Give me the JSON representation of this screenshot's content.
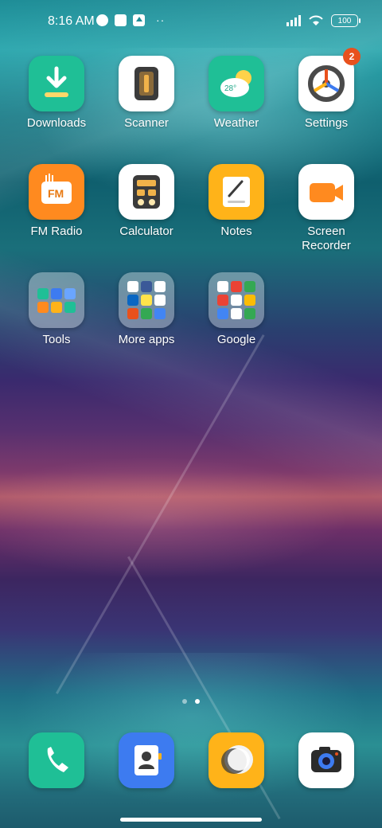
{
  "status_bar": {
    "time": "8:16 AM",
    "battery": "100",
    "more": "··"
  },
  "apps": [
    {
      "label": "Downloads",
      "icon": "download-icon",
      "color": "#1fbf96"
    },
    {
      "label": "Scanner",
      "icon": "scanner-icon",
      "color": "#ffffff"
    },
    {
      "label": "Weather",
      "icon": "weather-icon",
      "color": "#1fbf96",
      "temp": "28°"
    },
    {
      "label": "Settings",
      "icon": "settings-icon",
      "color": "#ffffff",
      "badge": "2"
    },
    {
      "label": "FM Radio",
      "icon": "radio-icon",
      "color": "#ff8a1f",
      "text": "FM"
    },
    {
      "label": "Calculator",
      "icon": "calculator-icon",
      "color": "#ffffff"
    },
    {
      "label": "Notes",
      "icon": "notes-icon",
      "color": "#ffb319"
    },
    {
      "label": "Screen\nRecorder",
      "icon": "screen-recorder-icon",
      "color": "#ffffff"
    },
    {
      "label": "Tools",
      "icon": "folder-icon"
    },
    {
      "label": "More apps",
      "icon": "folder-icon"
    },
    {
      "label": "Google",
      "icon": "folder-icon"
    }
  ],
  "dock": [
    {
      "name": "phone",
      "icon": "phone-icon",
      "color": "#1fbf96"
    },
    {
      "name": "contacts",
      "icon": "contacts-icon",
      "color": "#3d7bf0"
    },
    {
      "name": "messages",
      "icon": "messages-icon",
      "color": "#ffb319"
    },
    {
      "name": "camera",
      "icon": "camera-icon",
      "color": "#ffffff"
    }
  ],
  "pages": {
    "count": 2,
    "active": 2
  }
}
